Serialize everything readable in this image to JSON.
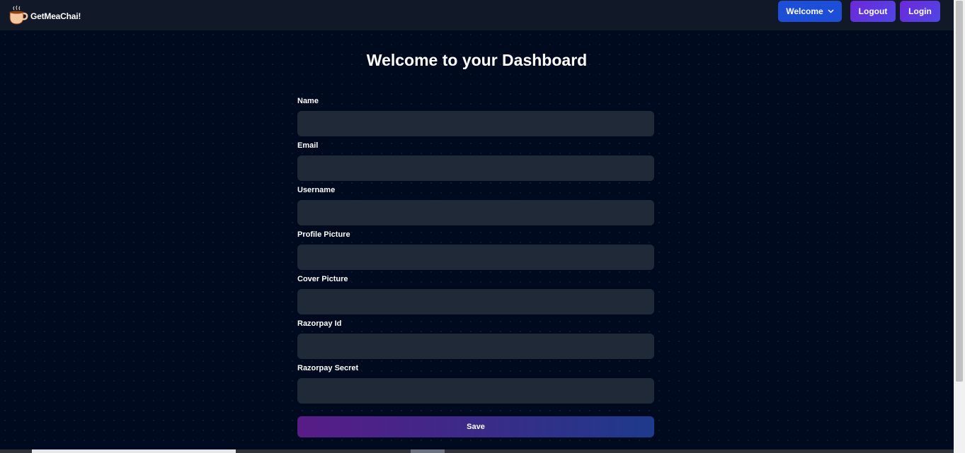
{
  "navbar": {
    "brand": "GetMeaChai!",
    "logo_icon": "tea-cup-icon",
    "welcome_label": "Welcome",
    "welcome_icon": "chevron-down-icon",
    "logout_label": "Logout",
    "login_label": "Login"
  },
  "page": {
    "title": "Welcome to your Dashboard"
  },
  "form": {
    "fields": [
      {
        "label": "Name",
        "value": ""
      },
      {
        "label": "Email",
        "value": ""
      },
      {
        "label": "Username",
        "value": ""
      },
      {
        "label": "Profile Picture",
        "value": ""
      },
      {
        "label": "Cover Picture",
        "value": ""
      },
      {
        "label": "Razorpay Id",
        "value": ""
      },
      {
        "label": "Razorpay Secret",
        "value": ""
      }
    ],
    "save_label": "Save"
  },
  "colors": {
    "background": "#000a1f",
    "navbar": "#111827",
    "input": "#1f2937",
    "welcome_button": "#1d4ed8",
    "accent_purple": "#6d28d9"
  }
}
